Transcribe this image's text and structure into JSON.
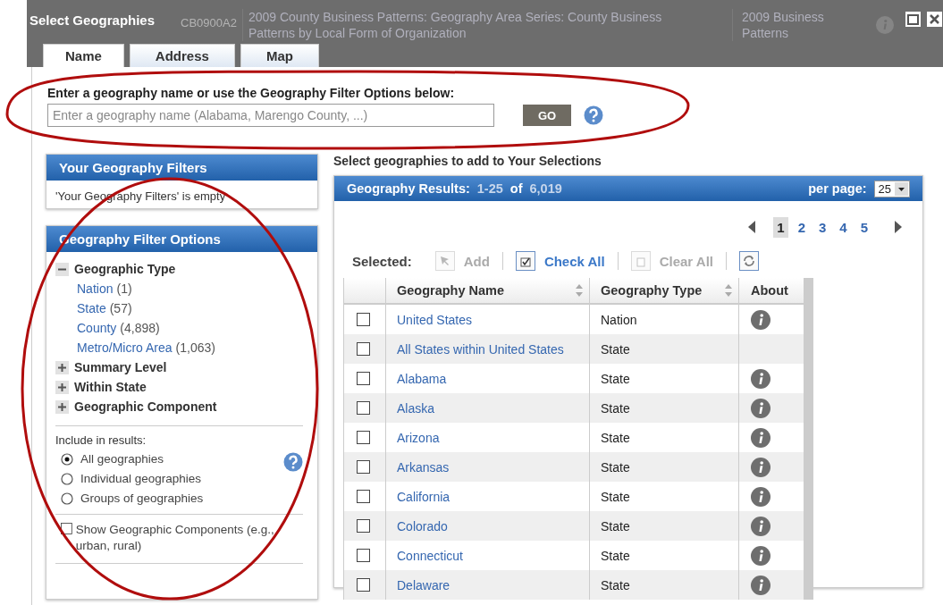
{
  "backdrop": {
    "rows": [
      {
        "code": "CB0900A2",
        "title_lines": [
          "2009 County Business Patterns: Geography Area Series: County Business",
          "Patterns by Local Form of Organization"
        ],
        "program_lines": [
          "2009 Business",
          "Patterns"
        ]
      }
    ]
  },
  "dialog": {
    "title": "Select Geographies"
  },
  "tabs": [
    {
      "label": "Name",
      "selected": true
    },
    {
      "label": "Address",
      "selected": false
    },
    {
      "label": "Map",
      "selected": false
    }
  ],
  "search": {
    "label": "Enter a geography name or use the Geography Filter Options below:",
    "placeholder": "Enter a geography name (Alabama, Marengo County, ...)",
    "button": "GO"
  },
  "filters_panel": {
    "title": "Your Geography Filters",
    "empty_text": "'Your Geography Filters' is empty"
  },
  "options_panel": {
    "title": "Geography Filter Options",
    "groups": [
      {
        "label": "Geographic Type",
        "expanded": true,
        "children": [
          {
            "label": "Nation",
            "count": "(1)"
          },
          {
            "label": "State",
            "count": "(57)"
          },
          {
            "label": "County",
            "count": "(4,898)"
          },
          {
            "label": "Metro/Micro Area",
            "count": "(1,063)"
          }
        ]
      },
      {
        "label": "Summary Level",
        "expanded": false
      },
      {
        "label": "Within State",
        "expanded": false
      },
      {
        "label": "Geographic Component",
        "expanded": false
      }
    ],
    "include_label": "Include in results:",
    "include_options": [
      {
        "label": "All geographies",
        "selected": true
      },
      {
        "label": "Individual geographies",
        "selected": false
      },
      {
        "label": "Groups of geographies",
        "selected": false
      }
    ],
    "show_components": {
      "label": "Show Geographic Components (e.g., urban, rural)",
      "checked": false
    }
  },
  "results": {
    "heading": "Select geographies to add to Your Selections",
    "title": "Geography Results:",
    "range": "1-25",
    "of": "of",
    "total": "6,019",
    "per_page_label": "per page:",
    "per_page": "25",
    "pages": [
      {
        "label": "1",
        "selected": true
      },
      {
        "label": "2",
        "selected": false
      },
      {
        "label": "3",
        "selected": false
      },
      {
        "label": "4",
        "selected": false
      },
      {
        "label": "5",
        "selected": false
      }
    ],
    "selected_label": "Selected:",
    "actions": [
      {
        "kind": "add",
        "label": "Add",
        "disabled": true
      },
      {
        "kind": "check",
        "label": "Check All",
        "disabled": false
      },
      {
        "kind": "clear",
        "label": "Clear All",
        "disabled": true
      }
    ],
    "columns": [
      {
        "label": "Geography Name",
        "sortable": true
      },
      {
        "label": "Geography Type",
        "sortable": true
      },
      {
        "label": "About",
        "sortable": false
      }
    ],
    "rows": [
      {
        "name": "United States",
        "type": "Nation",
        "checked": false,
        "info": true
      },
      {
        "name": "All States within United States",
        "type": "State",
        "checked": false,
        "info": false
      },
      {
        "name": "Alabama",
        "type": "State",
        "checked": false,
        "info": true
      },
      {
        "name": "Alaska",
        "type": "State",
        "checked": false,
        "info": true
      },
      {
        "name": "Arizona",
        "type": "State",
        "checked": false,
        "info": true
      },
      {
        "name": "Arkansas",
        "type": "State",
        "checked": false,
        "info": true
      },
      {
        "name": "California",
        "type": "State",
        "checked": false,
        "info": true
      },
      {
        "name": "Colorado",
        "type": "State",
        "checked": false,
        "info": true
      },
      {
        "name": "Connecticut",
        "type": "State",
        "checked": false,
        "info": true
      },
      {
        "name": "Delaware",
        "type": "State",
        "checked": false,
        "info": true
      }
    ]
  },
  "annotations": [
    {
      "kind": "ellipse"
    },
    {
      "kind": "ellipse"
    }
  ]
}
